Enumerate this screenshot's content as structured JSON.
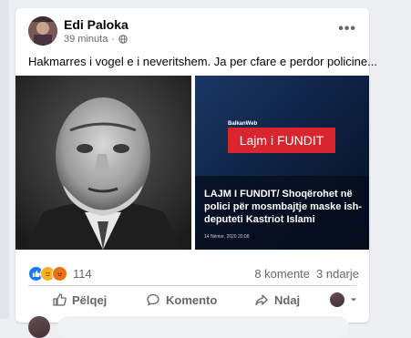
{
  "post": {
    "author": "Edi Paloka",
    "time": "39 minuta",
    "separator": "·",
    "more": "•••",
    "text": "Hakmarres i vogel e i neveritshem. Ja per cfare e perdor policine..."
  },
  "news_image": {
    "logo": "BalkanWeb",
    "banner": "Lajm i FUNDIT",
    "headline": "LAJM I FUNDIT/ Shoqërohet në polici për mosmbajtje maske ish-deputeti Kastriot Islami",
    "dateline": "14 Nëntor, 2020 20:08"
  },
  "engagement": {
    "reaction_count": "114",
    "comments": "8 komente",
    "shares": "3 ndarje",
    "reaction_icons": [
      "like-icon",
      "care-icon",
      "angry-icon"
    ]
  },
  "actions": {
    "like": "Pëlqej",
    "comment": "Komento",
    "share": "Ndaj",
    "audience_icon": "chevron-down-icon"
  },
  "colors": {
    "like_blue": "#1877f2",
    "banner_red": "#d9252e",
    "news_bg": "#0d1e3a"
  }
}
